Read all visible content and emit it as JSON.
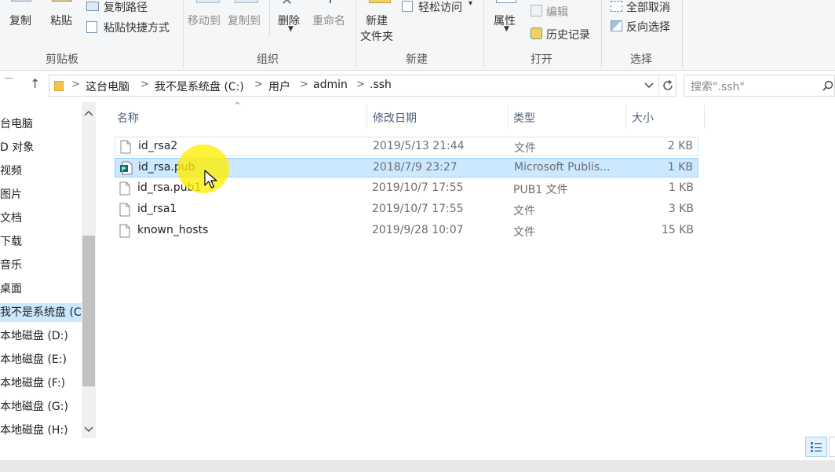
{
  "ribbon": {
    "clipboard": {
      "group_label": "剪贴板",
      "copy": "复制",
      "paste": "粘贴",
      "copy_path": "复制路径",
      "paste_shortcut": "粘贴快捷方式"
    },
    "organize": {
      "group_label": "组织",
      "move_to": "移动到",
      "copy_to": "复制到",
      "delete": "删除",
      "rename": "重命名"
    },
    "new": {
      "group_label": "新建",
      "new_folder_line1": "新建",
      "new_folder_line2": "文件夹",
      "easy_access": "轻松访问",
      "easy_access_caret": "▾"
    },
    "open": {
      "group_label": "打开",
      "properties": "属性",
      "edit": "编辑",
      "history": "历史记录"
    },
    "select": {
      "group_label": "选择",
      "select_none": "全部取消",
      "invert": "反向选择"
    }
  },
  "address": {
    "back_arrow": "↑",
    "breadcrumbs": [
      "这台电脑",
      "我不是系统盘 (C:)",
      "用户",
      "admin",
      ".ssh"
    ],
    "separator": ">",
    "dropdown_icon": "chevron-down-icon",
    "refresh_icon": "refresh-icon"
  },
  "search": {
    "placeholder": "搜索\".ssh\""
  },
  "nav": {
    "items": [
      {
        "label": "台电脑"
      },
      {
        "label": "D 对象"
      },
      {
        "label": "视频"
      },
      {
        "label": "图片"
      },
      {
        "label": "文档"
      },
      {
        "label": "下载"
      },
      {
        "label": "音乐"
      },
      {
        "label": "桌面"
      },
      {
        "label": "我不是系统盘 (C"
      },
      {
        "label": "本地磁盘 (D:)"
      },
      {
        "label": "本地磁盘 (E:)"
      },
      {
        "label": "本地磁盘 (F:)"
      },
      {
        "label": "本地磁盘 (G:)"
      },
      {
        "label": "本地磁盘 (H:)"
      }
    ],
    "selected_index": 8
  },
  "files": {
    "headers": {
      "name": "名称",
      "date": "修改日期",
      "type": "类型",
      "size": "大小"
    },
    "rows": [
      {
        "name": "id_rsa2",
        "date": "2019/5/13 21:44",
        "type": "文件",
        "size": "2 KB"
      },
      {
        "name": "id_rsa.pub",
        "date": "2018/7/9 23:27",
        "type": "Microsoft Publis...",
        "size": "1 KB"
      },
      {
        "name": "id_rsa.pub1",
        "date": "2019/10/7 17:55",
        "type": "PUB1 文件",
        "size": "1 KB"
      },
      {
        "name": "id_rsa1",
        "date": "2019/10/7 17:55",
        "type": "文件",
        "size": "3 KB"
      },
      {
        "name": "known_hosts",
        "date": "2019/9/28 10:07",
        "type": "文件",
        "size": "15 KB"
      }
    ],
    "selected_index": 1,
    "hover_index": 0
  },
  "colors": {
    "selection": "#cce8ff",
    "highlight": "#ffee00",
    "header_text": "#4c607a"
  }
}
